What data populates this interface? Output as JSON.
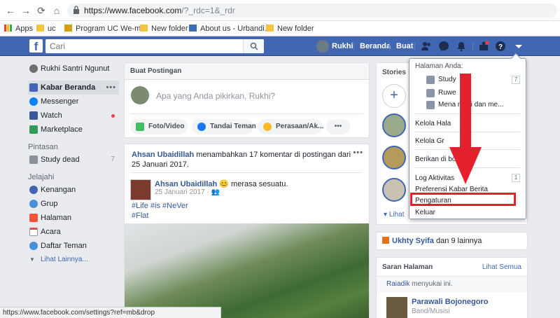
{
  "browser": {
    "url_host": "https://www.facebook.com",
    "url_path": "/?_rdc=1&_rdr",
    "bookmarks": [
      {
        "label": "Apps",
        "icon": "apps-grid-icon"
      },
      {
        "label": "uc",
        "icon": "folder-icon"
      },
      {
        "label": "Program UC We-m...",
        "icon": "bookmark-page-icon"
      },
      {
        "label": "New folder",
        "icon": "folder-icon"
      },
      {
        "label": "About us - Urbandi...",
        "icon": "shield-page-icon"
      },
      {
        "label": "New folder",
        "icon": "folder-icon"
      }
    ],
    "status_url": "https://www.facebook.com/settings?ref=mb&drop"
  },
  "header": {
    "logo": "f",
    "search_placeholder": "Cari",
    "user": "Rukhi",
    "beranda": "Beranda",
    "buat": "Buat"
  },
  "sidebar": {
    "profile": "Rukhi Santri Ngunut",
    "items": [
      {
        "label": "Kabar Beranda",
        "more": "•••"
      },
      {
        "label": "Messenger"
      },
      {
        "label": "Watch"
      },
      {
        "label": "Marketplace"
      }
    ],
    "pintasan_title": "Pintasan",
    "pintasan": [
      {
        "label": "Study dead",
        "count": "7"
      }
    ],
    "jelajahi_title": "Jelajahi",
    "jelajahi": [
      {
        "label": "Kenangan"
      },
      {
        "label": "Grup"
      },
      {
        "label": "Halaman"
      },
      {
        "label": "Acara"
      },
      {
        "label": "Daftar Teman"
      }
    ],
    "lihat_lainnya": "Lihat Lainnya..."
  },
  "composer": {
    "title": "Buat Postingan",
    "placeholder": "Apa yang Anda pikirkan, Rukhi?",
    "btn_photo": "Foto/Video",
    "btn_tag": "Tandai Teman",
    "btn_feeling": "Perasaan/Ak...",
    "btn_more": "•••"
  },
  "post": {
    "actor": "Ahsan Ubaidillah",
    "action": " menambahkan 17 komentar di postingan dari 25 Januari 2017.",
    "more": "•••",
    "author": "Ahsan Ubaidillah",
    "feeling": " 😊 merasa sesuatu.",
    "date": "25 Januari 2017 · ",
    "tags": [
      "#Life #is #NeVer",
      "#Flat"
    ]
  },
  "stories": {
    "title": "Stories",
    "add": "+",
    "lihat": "Lihat"
  },
  "birthday": {
    "name": "Ukhty Syifa",
    "rest": " dan 9 lainnya"
  },
  "saran": {
    "title": "Saran Halaman",
    "lihat_semua": "Lihat Semua",
    "liker": "Raiadik",
    "liker_rest": " menyukai ini.",
    "page_name": "Parawali Bojonegoro",
    "page_cat": "Band/Musisi"
  },
  "dropdown": {
    "title": "Halaman Anda:",
    "pages": [
      {
        "label": "Study",
        "count": "7"
      },
      {
        "label": "Ruwe"
      },
      {
        "label": "Mena   mosi dan me..."
      }
    ],
    "items": [
      "Kelola Hala",
      "Kelola Gr",
      "Berikan di   book",
      "Log Aktivitas",
      "Preferensi Kabar Berita",
      "Pengaturan",
      "Keluar"
    ],
    "log_count": "1"
  },
  "colors": {
    "fb_blue": "#4267b2",
    "highlight_red": "#e4202f"
  }
}
